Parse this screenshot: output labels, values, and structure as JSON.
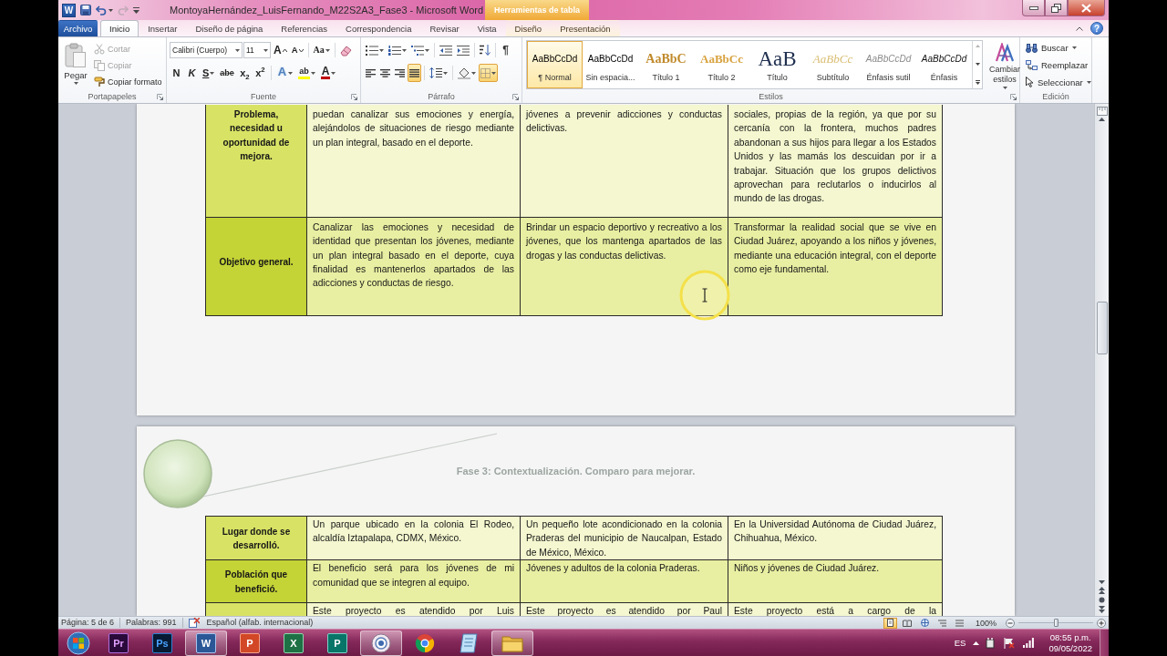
{
  "title_bar": {
    "app_letter": "W",
    "title": "MontoyaHernández_LuisFernando_M22S2A3_Fase3 - Microsoft Word",
    "context_group": "Herramientas de tabla",
    "help": "?"
  },
  "tabs": [
    {
      "label": "Archivo",
      "kind": "file",
      "selected": false
    },
    {
      "label": "Inicio",
      "kind": "main",
      "selected": true
    },
    {
      "label": "Insertar",
      "kind": "main",
      "selected": false
    },
    {
      "label": "Diseño de página",
      "kind": "main",
      "selected": false
    },
    {
      "label": "Referencias",
      "kind": "main",
      "selected": false
    },
    {
      "label": "Correspondencia",
      "kind": "main",
      "selected": false
    },
    {
      "label": "Revisar",
      "kind": "main",
      "selected": false
    },
    {
      "label": "Vista",
      "kind": "main",
      "selected": false
    },
    {
      "label": "Diseño",
      "kind": "context",
      "selected": false
    },
    {
      "label": "Presentación",
      "kind": "context",
      "selected": false
    }
  ],
  "clipboard": {
    "group": "Portapapeles",
    "paste": "Pegar",
    "tools": [
      {
        "kind": "cut",
        "label": "Cortar",
        "disabled": true
      },
      {
        "kind": "copy",
        "label": "Copiar",
        "disabled": true
      },
      {
        "kind": "painter",
        "label": "Copiar formato",
        "disabled": false
      }
    ]
  },
  "font": {
    "group": "Fuente",
    "name": "Calibri (Cuerpo)",
    "size": "11",
    "size_tools": [
      {
        "kind": "grow",
        "label": "A"
      },
      {
        "kind": "shrink",
        "label": "A"
      },
      {
        "kind": "case",
        "label": "Aa"
      }
    ],
    "format_tools": [
      {
        "kind": "bold",
        "label": "N"
      },
      {
        "kind": "italic",
        "label": "K"
      },
      {
        "kind": "underline",
        "label": "S"
      },
      {
        "kind": "strike",
        "label": "abe"
      },
      {
        "kind": "sub",
        "label": "x$_{2}$"
      },
      {
        "kind": "sup",
        "label": "x$^{2}$"
      }
    ],
    "color_tools": [
      {
        "kind": "effects",
        "label": "A"
      },
      {
        "kind": "highlight",
        "label": "ab"
      },
      {
        "kind": "color",
        "label": "A"
      }
    ]
  },
  "paragraph": {
    "group": "Párrafo",
    "marks": "¶",
    "align": [
      {
        "kind": "left",
        "selected": false
      },
      {
        "kind": "center",
        "selected": false
      },
      {
        "kind": "right",
        "selected": false
      },
      {
        "kind": "justify",
        "selected": true
      }
    ],
    "borders": {
      "selected": true
    }
  },
  "styles": {
    "group": "Estilos",
    "items": [
      {
        "kind": "normal",
        "preview": "AaBbCcDd",
        "name": "¶ Normal",
        "selected": true
      },
      {
        "kind": "no_spacing",
        "preview": "AaBbCcDd",
        "name": "Sin espacia...",
        "selected": false
      },
      {
        "kind": "heading1",
        "preview": "AaBbC",
        "name": "Título 1",
        "selected": false
      },
      {
        "kind": "heading2",
        "preview": "AaBbCc",
        "name": "Título 2",
        "selected": false
      },
      {
        "kind": "title",
        "preview": "AaB",
        "name": "Título",
        "selected": false
      },
      {
        "kind": "subtitle",
        "preview": "AaBbCc",
        "name": "Subtítulo",
        "selected": false
      },
      {
        "kind": "subtle",
        "preview": "AaBbCcDd",
        "name": "Énfasis sutil",
        "selected": false
      },
      {
        "kind": "emphasis",
        "preview": "AaBbCcDd",
        "name": "Énfasis",
        "selected": false
      }
    ],
    "change": "Cambiar estilos"
  },
  "editing": {
    "group": "Edición",
    "tools": [
      {
        "kind": "find",
        "label": "Buscar"
      },
      {
        "kind": "replace",
        "label": "Reemplazar"
      },
      {
        "kind": "select",
        "label": "Seleccionar"
      }
    ]
  },
  "page_1": {
    "table": {
      "rows": [
        {
          "kind": "cut_top",
          "header": "Problema, necesidad u oportunidad de mejora.",
          "cells": [
            "puedan canalizar sus emociones y energía, alejándolos de situaciones de riesgo mediante un plan integral, basado en el deporte.",
            "jóvenes a prevenir adicciones y conductas delictivas.",
            "sociales, propias de la región, ya que por su cercanía con la frontera, muchos padres abandonan a sus hijos para llegar a los Estados Unidos y las mamás los descuidan por ir a trabajar. Situación que los grupos delictivos aprovechan para reclutarlos o inducirlos al mundo de las drogas."
          ]
        },
        {
          "kind": "full",
          "header": "Objetivo general.",
          "cells": [
            "Canalizar las emociones y necesidad de identidad que presentan los jóvenes, mediante un plan integral basado en el deporte, cuya finalidad es mantenerlos apartados de las adicciones y conductas de riesgo.",
            "Brindar un espacio deportivo y recreativo a los jóvenes, que los mantenga apartados de las drogas y las conductas delictivas.",
            "Transformar la realidad social que se vive en Ciudad Juárez, apoyando a los niños y jóvenes, mediante una educación integral, con el deporte como eje fundamental."
          ]
        }
      ]
    }
  },
  "page_2": {
    "heading": "Fase 3: Contextualización. Comparo para mejorar.",
    "table": {
      "rows": [
        {
          "kind": "full",
          "header": "Lugar donde se desarrolló.",
          "cells": [
            "Un parque ubicado en la colonia El Rodeo, alcaldía Iztapalapa, CDMX, México.",
            "Un pequeño lote acondicionado en la colonia Praderas del municipio de Naucalpan, Estado de México, México.",
            "En la Universidad Autónoma de Ciudad Juárez, Chihuahua, México."
          ]
        },
        {
          "kind": "full",
          "header": "Población que benefició.",
          "cells": [
            "El beneficio será para los jóvenes de mi comunidad que se integren al equipo.",
            "Jóvenes y adultos de la colonia Praderas.",
            "Niños y jóvenes de Ciudad Juárez."
          ]
        },
        {
          "kind": "cut_bottom",
          "cells": [
            "Este proyecto es atendido por Luis",
            "Este proyecto es atendido por Paul",
            "Este proyecto está a cargo de la"
          ]
        }
      ]
    }
  },
  "status_bar": {
    "page": "Página: 5 de 6",
    "words": "Palabras: 991",
    "language": "Español (alfab. internacional)",
    "views": [
      {
        "kind": "print",
        "selected": true
      },
      {
        "kind": "reading",
        "selected": false
      },
      {
        "kind": "web",
        "selected": false
      },
      {
        "kind": "outline",
        "selected": false
      },
      {
        "kind": "draft",
        "selected": false
      }
    ],
    "zoom": "100%",
    "zoom_slider": {
      "level": 0.5
    }
  },
  "taskbar": {
    "apps": [
      {
        "kind": "video",
        "label": "Pr",
        "running": false
      },
      {
        "kind": "photo",
        "label": "Ps",
        "running": false
      },
      {
        "kind": "word",
        "label": "W",
        "running": true
      },
      {
        "kind": "slides",
        "label": "P",
        "running": false
      },
      {
        "kind": "sheet",
        "label": "X",
        "running": false
      },
      {
        "kind": "publisher",
        "label": "P",
        "running": false
      },
      {
        "kind": "recorder",
        "running": true
      },
      {
        "kind": "browser",
        "running": false
      },
      {
        "kind": "notes",
        "running": false
      },
      {
        "kind": "folder",
        "running": true
      }
    ],
    "language": "ES",
    "time": "08:55 p.m.",
    "date": "09/05/2022"
  }
}
